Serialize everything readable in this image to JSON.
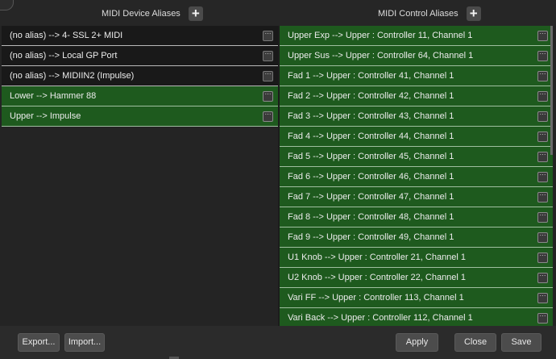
{
  "device_panel": {
    "title": "MIDI Device Aliases",
    "add_label": "+",
    "rows": [
      {
        "label": "(no alias) --> 4- SSL 2+ MIDI",
        "selected": false
      },
      {
        "label": "(no alias) --> Local GP Port",
        "selected": false
      },
      {
        "label": "(no alias) --> MIDIIN2 (Impulse)",
        "selected": false
      },
      {
        "label": "Lower --> Hammer 88",
        "selected": true
      },
      {
        "label": "Upper --> Impulse",
        "selected": true
      }
    ]
  },
  "control_panel": {
    "title": "MIDI Control Aliases",
    "add_label": "+",
    "rows": [
      {
        "label": "Upper Exp --> Upper : Controller 11, Channel 1"
      },
      {
        "label": "Upper Sus --> Upper : Controller 64, Channel 1"
      },
      {
        "label": "Fad 1 --> Upper : Controller 41, Channel 1"
      },
      {
        "label": "Fad 2 --> Upper : Controller 42, Channel 1"
      },
      {
        "label": "Fad 3 --> Upper : Controller 43, Channel 1"
      },
      {
        "label": "Fad 4 --> Upper : Controller 44, Channel 1"
      },
      {
        "label": "Fad 5 --> Upper : Controller 45, Channel 1"
      },
      {
        "label": "Fad 6 --> Upper : Controller 46, Channel 1"
      },
      {
        "label": "Fad 7 --> Upper : Controller 47, Channel 1"
      },
      {
        "label": "Fad 8 --> Upper : Controller 48, Channel 1"
      },
      {
        "label": "Fad 9 --> Upper : Controller 49, Channel 1"
      },
      {
        "label": "U1 Knob --> Upper : Controller 21, Channel 1"
      },
      {
        "label": "U2 Knob --> Upper : Controller 22, Channel 1"
      },
      {
        "label": "Vari FF --> Upper : Controller 113, Channel 1"
      },
      {
        "label": "Vari Back --> Upper : Controller 112, Channel 1"
      }
    ]
  },
  "row_menu_glyph": "···",
  "footer": {
    "export_label": "Export...",
    "import_label": "Import...",
    "apply_label": "Apply",
    "close_label": "Close",
    "save_label": "Save"
  },
  "colors": {
    "selected_row": "#1e5a1e",
    "row": "#191919",
    "background": "#242424"
  }
}
